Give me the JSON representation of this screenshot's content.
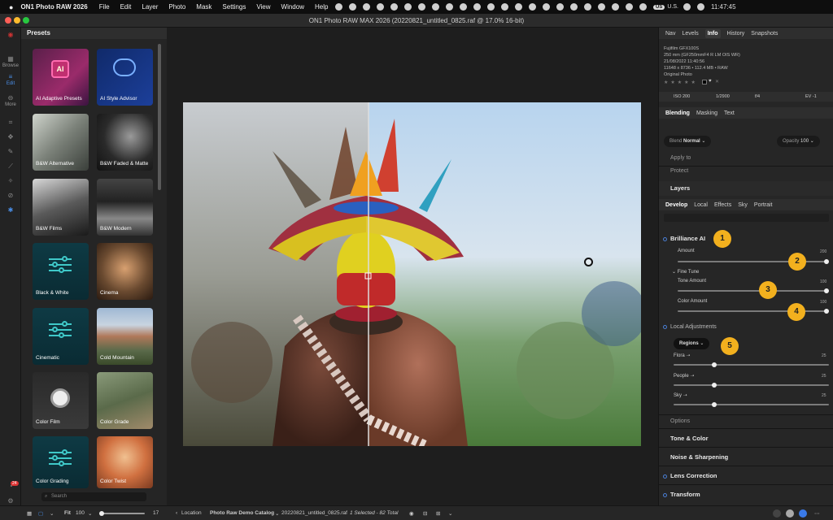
{
  "menubar": {
    "app": "ON1 Photo RAW 2026",
    "items": [
      "File",
      "Edit",
      "Layer",
      "Photo",
      "Mask",
      "Settings",
      "View",
      "Window",
      "Help"
    ],
    "input_source": "U.S.",
    "time": "11:47:45"
  },
  "window": {
    "title": "ON1 Photo RAW MAX 2026 (20220821_untitled_0825.raf @ 17.0% 16-bit)"
  },
  "toolstrip": {
    "browse": "Browse",
    "edit": "Edit",
    "more": "More"
  },
  "presets": {
    "title": "Presets",
    "tiles": [
      "AI Adaptive Presets",
      "AI Style Advisor",
      "B&W Alternative",
      "B&W Faded & Matte",
      "B&W Films",
      "B&W Modern",
      "Black & White",
      "Cinema",
      "Cinematic",
      "Cold Mountain",
      "Color Film",
      "Color Grade",
      "Color Grading",
      "Color Twist"
    ],
    "search_placeholder": "Search"
  },
  "info": {
    "tabs": [
      "Nav",
      "Levels",
      "Info",
      "History",
      "Snapshots"
    ],
    "active_tab": "Info",
    "camera": "Fujifilm GFX100S",
    "lens": "250 mm (GF250mmF4 R LM OIS WR)",
    "date": "21/08/2022 11:40:56",
    "dims": "11648 x 8736 • 112.4 MB • RAW",
    "original": "Original Photo",
    "iso": "ISO 200",
    "shutter": "1/2900",
    "aperture": "f/4",
    "ev": "EV -1"
  },
  "blending": {
    "tabs": [
      "Blending",
      "Masking",
      "Text"
    ],
    "blend_label": "Blend",
    "blend_value": "Normal",
    "opacity_label": "Opacity",
    "opacity_value": "100",
    "apply_to": "Apply to",
    "protect": "Protect"
  },
  "layers": {
    "title": "Layers"
  },
  "develop": {
    "tabs": [
      "Develop",
      "Local",
      "Effects",
      "Sky",
      "Portrait"
    ],
    "brilliance": {
      "title": "Brilliance AI",
      "amount_label": "Amount",
      "amount_value": "200",
      "fine_tune": "Fine Tune",
      "tone_label": "Tone Amount",
      "tone_value": "100",
      "color_label": "Color Amount",
      "color_value": "100"
    },
    "local": {
      "title": "Local Adjustments",
      "regions": "Regions",
      "rows": [
        {
          "label": "Flora",
          "value": "25"
        },
        {
          "label": "People",
          "value": "25"
        },
        {
          "label": "Sky",
          "value": "25"
        }
      ]
    },
    "options": "Options",
    "sections": [
      "Tone & Color",
      "Noise & Sharpening",
      "Lens Correction",
      "Transform"
    ]
  },
  "badges": [
    "1",
    "2",
    "3",
    "4",
    "5"
  ],
  "bottombar": {
    "zoom_mode": "Fit",
    "zoom_value": "100",
    "slider_value": "17",
    "location": "Location",
    "catalog": "Photo Raw Demo Catalog",
    "filename": "20220821_untitled_0825.raf",
    "selection": "1 Selected - 82 Total",
    "notif_count": "24"
  }
}
